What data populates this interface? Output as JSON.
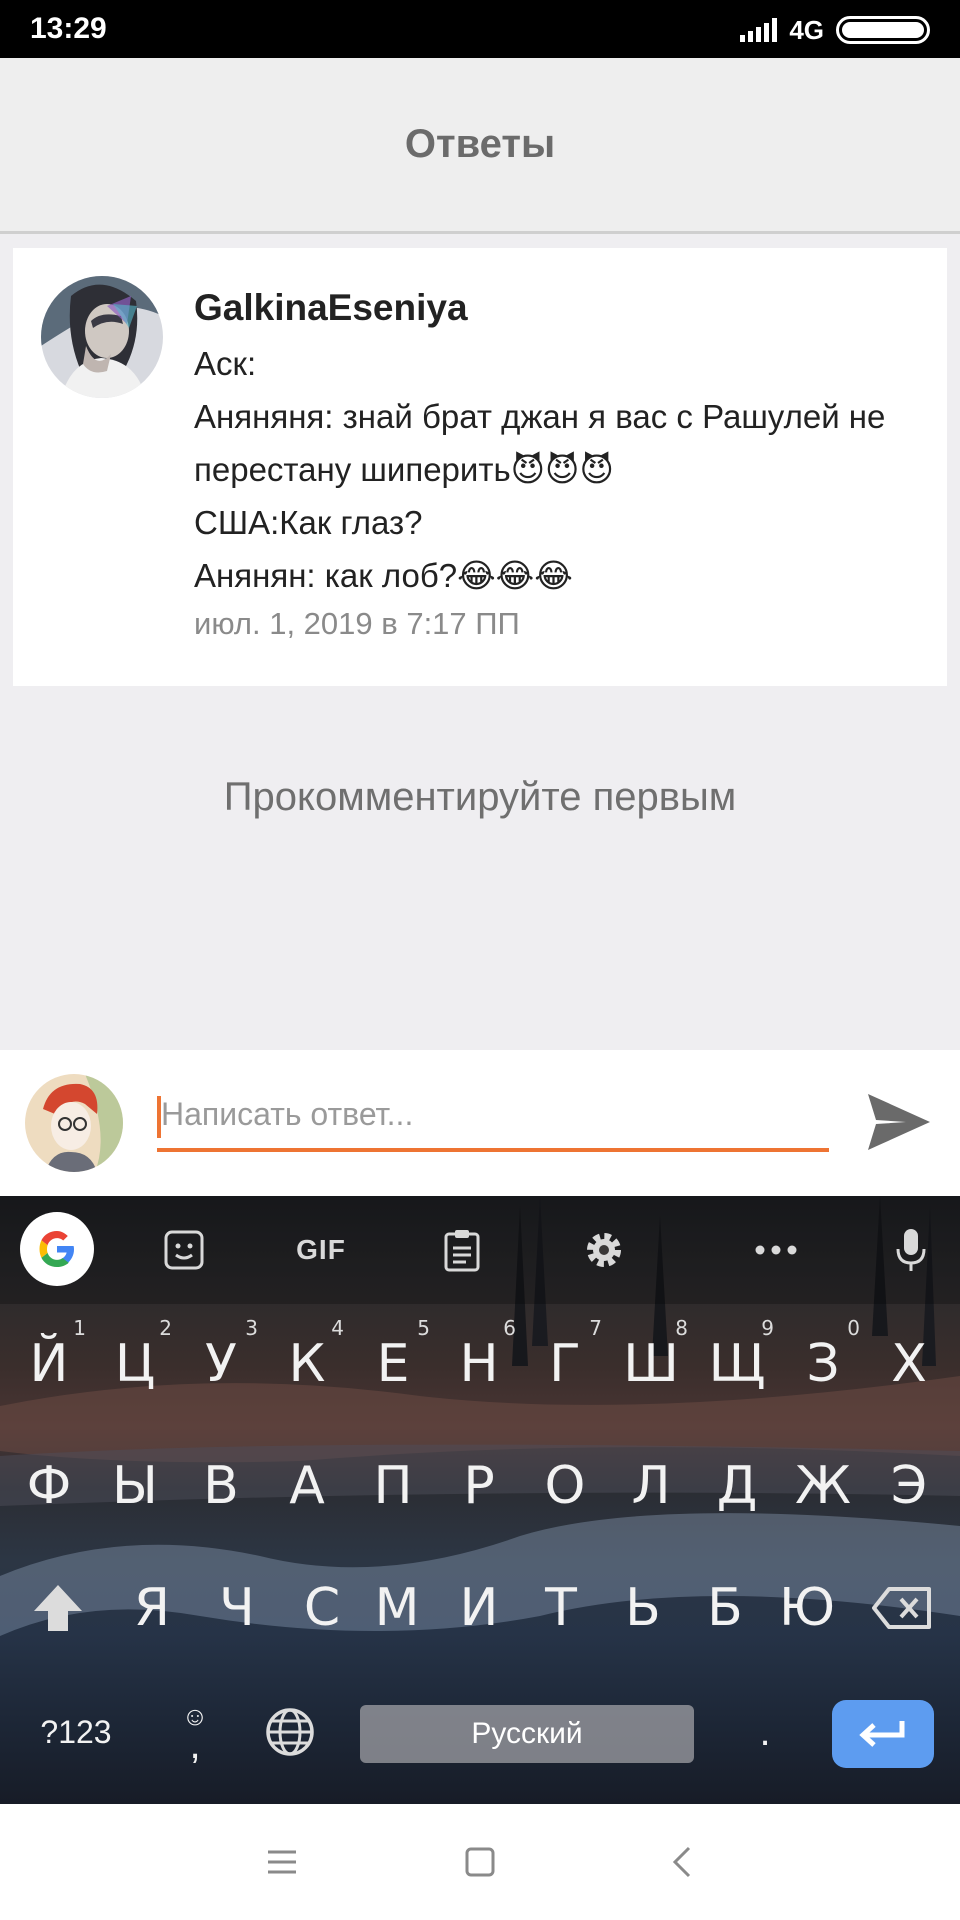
{
  "status": {
    "time": "13:29",
    "network": "4G"
  },
  "header": {
    "title": "Ответы"
  },
  "post": {
    "author": "GalkinaEseniya",
    "lines": [
      "Аск:",
      "Аняняня: знай брат джан я вас с Рашулей не",
      "перестану шиперить😈😈😈",
      "США:Как глаз?",
      "Анянян: как лоб?😂😂😂"
    ],
    "date": "июл. 1, 2019 в 7:17 ПП"
  },
  "comments": {
    "empty_text": "Прокомментируйте первым"
  },
  "reply": {
    "placeholder": "Написать ответ..."
  },
  "keyboard": {
    "toolbar": {
      "gif_label": "GIF"
    },
    "row1": [
      {
        "label": "Й",
        "hint": "1"
      },
      {
        "label": "Ц",
        "hint": "2"
      },
      {
        "label": "У",
        "hint": "3"
      },
      {
        "label": "К",
        "hint": "4"
      },
      {
        "label": "Е",
        "hint": "5"
      },
      {
        "label": "Н",
        "hint": "6"
      },
      {
        "label": "Г",
        "hint": "7"
      },
      {
        "label": "Ш",
        "hint": "8"
      },
      {
        "label": "Щ",
        "hint": "9"
      },
      {
        "label": "З",
        "hint": "0"
      },
      {
        "label": "Х",
        "hint": ""
      }
    ],
    "row2": [
      "Ф",
      "Ы",
      "В",
      "А",
      "П",
      "Р",
      "О",
      "Л",
      "Д",
      "Ж",
      "Э"
    ],
    "row3": [
      "Я",
      "Ч",
      "С",
      "М",
      "И",
      "Т",
      "Ь",
      "Б",
      "Ю"
    ],
    "symbols_label": "?123",
    "comma_label": ",",
    "space_label": "Русский",
    "period_label": "."
  },
  "colors": {
    "accent": "#ee7433",
    "enter_key": "#5d9cf0",
    "header_bg": "#eeeeee"
  }
}
